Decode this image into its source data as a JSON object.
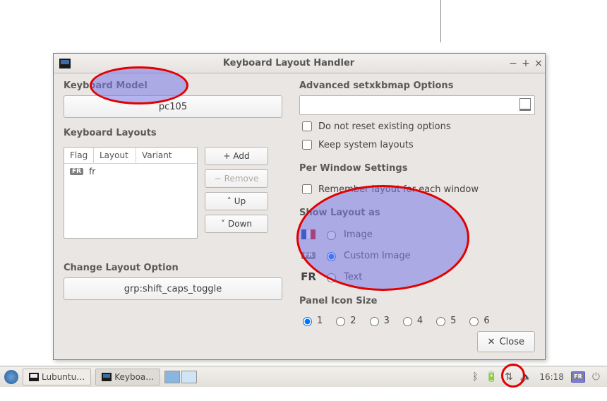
{
  "dialog": {
    "title": "Keyboard Layout Handler",
    "close_label": "Close"
  },
  "left": {
    "model_label": "Keyboard Model",
    "model_value": "pc105",
    "layouts_label": "Keyboard Layouts",
    "columns": {
      "flag": "Flag",
      "layout": "Layout",
      "variant": "Variant"
    },
    "rows": [
      {
        "flag_badge": "FR",
        "layout": "fr",
        "variant": ""
      }
    ],
    "buttons": {
      "add": "Add",
      "remove": "Remove",
      "up": "Up",
      "down": "Down"
    },
    "change_option_label": "Change Layout Option",
    "change_option_value": "grp:shift_caps_toggle"
  },
  "right": {
    "advanced_label": "Advanced setxkbmap Options",
    "advanced_value": "",
    "donotreset_label": "Do not reset existing options",
    "keepsystem_label": "Keep system layouts",
    "perwindow_label": "Per Window Settings",
    "remember_label": "Remember layout for each window",
    "showlayout_label": "Show Layout as",
    "radio_image": "Image",
    "radio_custom": "Custom Image",
    "radio_text": "Text",
    "radio_text_sample": "FR",
    "radio_custom_badge": "FR",
    "paneliconsize_label": "Panel Icon Size",
    "sizes": [
      "1",
      "2",
      "3",
      "4",
      "5",
      "6"
    ],
    "selected_radio": "custom",
    "selected_size": "1"
  },
  "taskbar": {
    "items": [
      {
        "label": "Lubuntu…"
      },
      {
        "label": "Keyboa…"
      }
    ],
    "time": "16:18",
    "kb_indicator": "FR"
  }
}
